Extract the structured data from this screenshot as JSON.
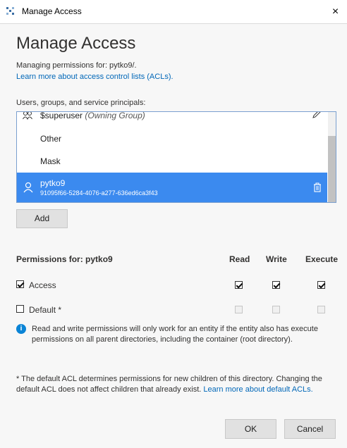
{
  "window": {
    "title": "Manage Access",
    "close_label": "×"
  },
  "dialog": {
    "heading": "Manage Access",
    "managing_text": "Managing permissions for: pytko9/.",
    "learn_more_acl": "Learn more about access control lists (ACLs).",
    "principals_label": "Users, groups, and service principals:",
    "principals": [
      {
        "name": "$superuser",
        "suffix": "(Owning Group)"
      },
      {
        "name": "Other"
      },
      {
        "name": "Mask"
      },
      {
        "name": "pytko9",
        "id": "91095f66-5284-4076-a277-636ed6ca3f43",
        "selected": true
      }
    ],
    "add_button": "Add",
    "permissions_for": "Permissions for: pytko9",
    "columns": [
      "Read",
      "Write",
      "Execute"
    ],
    "rows": [
      {
        "label": "Access",
        "enabled": true,
        "read": true,
        "write": true,
        "execute": true
      },
      {
        "label": "Default *",
        "enabled": false,
        "read": false,
        "write": false,
        "execute": false
      }
    ],
    "info_text": "Read and write permissions will only work for an entity if the entity also has execute permissions on all parent directories, including the container (root directory).",
    "footnote_text": "* The default ACL determines permissions for new children of this directory. Changing the default ACL does not affect children that already exist.",
    "footnote_link": "Learn more about default ACLs.",
    "ok_button": "OK",
    "cancel_button": "Cancel"
  },
  "colors": {
    "selected_row": "#3b8aef",
    "link": "#0067b8",
    "info_icon": "#0a84d6"
  }
}
